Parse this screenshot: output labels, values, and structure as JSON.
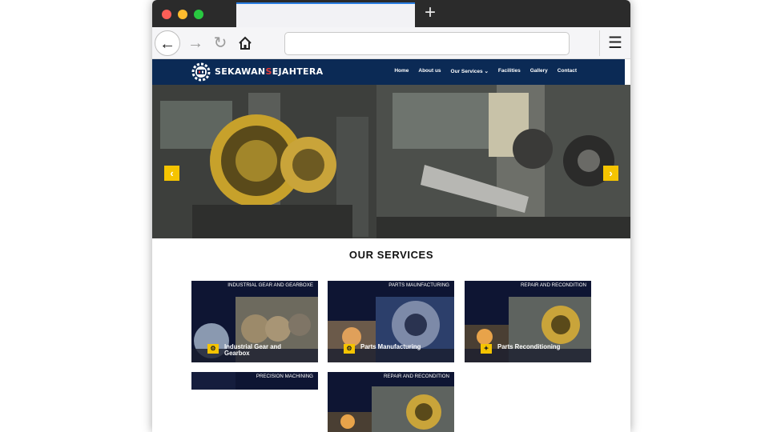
{
  "browser": {
    "window_dots": [
      "#fe5f57",
      "#febc2e",
      "#28c840"
    ],
    "new_tab_label": "+",
    "back_icon": "←",
    "forward_icon": "→",
    "reload_icon": "↻",
    "menu_icon": "☰",
    "address_value": ""
  },
  "site": {
    "logo": {
      "part1": "SEKAWAN",
      "part2": "S",
      "part3": "EJAHTERA"
    },
    "nav": [
      {
        "label": "Home"
      },
      {
        "label": "About us"
      },
      {
        "label": "Our Services ⌄"
      },
      {
        "label": "Facilities"
      },
      {
        "label": "Gallery"
      },
      {
        "label": "Contact"
      }
    ],
    "hero": {
      "prev_icon": "‹",
      "next_icon": "›"
    },
    "services_title": "OUR SERVICES",
    "cards": [
      {
        "header": "INDUSTRIAL GEAR AND GEARBOXE",
        "caption": "Industrial Gear and Gearbox",
        "icon": "gear-icon"
      },
      {
        "header": "PARTS MAUNFACTURING",
        "caption": "Parts Manufacturing",
        "icon": "gear-icon"
      },
      {
        "header": "REPAIR AND RECONDITION",
        "caption": "Parts Reconditioning",
        "icon": "bulb-icon"
      },
      {
        "header": "PRECISION MACHINING",
        "caption": "",
        "icon": ""
      },
      {
        "header": "REPAIR AND RECONDITION",
        "caption": "",
        "icon": ""
      }
    ],
    "colors": {
      "nav_bg": "#0b2a55",
      "accent": "#f5c400"
    }
  }
}
